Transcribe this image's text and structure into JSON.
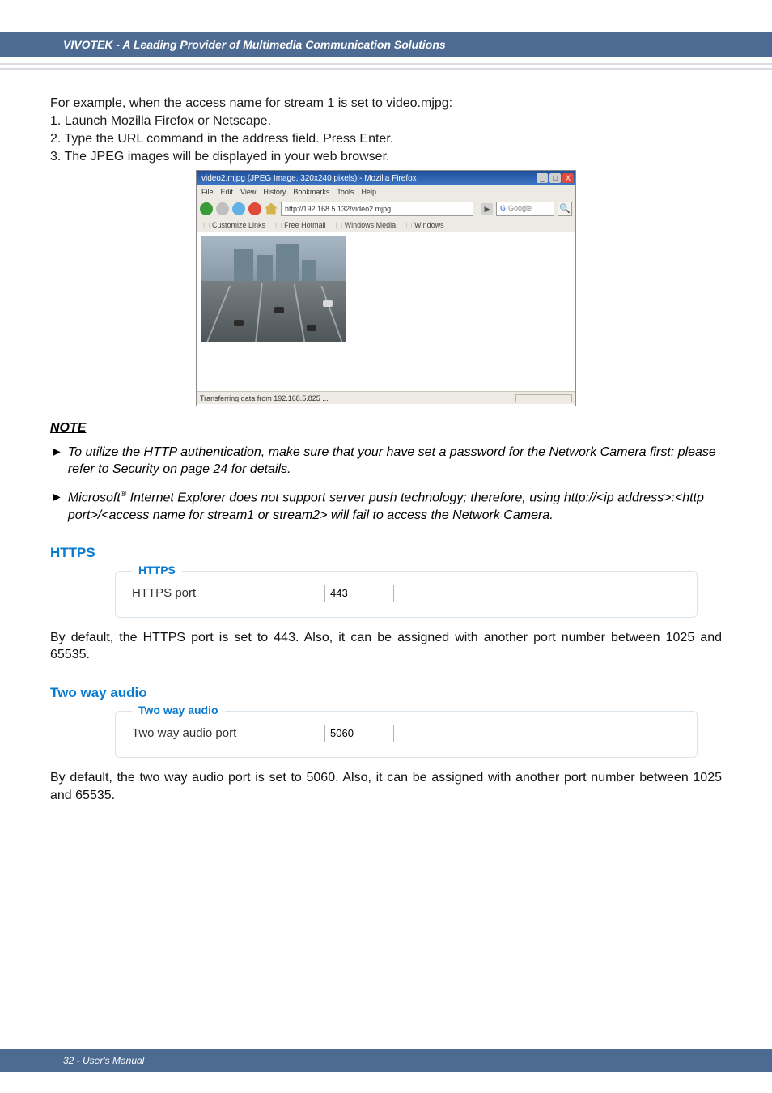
{
  "header": {
    "brand": "VIVOTEK - A Leading Provider of Multimedia Communication Solutions"
  },
  "intro": {
    "line0": "For example, when the access name for stream 1 is set to video.mjpg:",
    "line1": "1. Launch Mozilla Firefox or Netscape.",
    "line2": "2. Type the URL command in the address field. Press Enter.",
    "line3": "3. The JPEG images will be displayed in your web browser."
  },
  "firefox": {
    "title": "video2.mjpg (JPEG Image, 320x240 pixels) - Mozilla Firefox",
    "menus": [
      "File",
      "Edit",
      "View",
      "History",
      "Bookmarks",
      "Tools",
      "Help"
    ],
    "address": "http://192.168.5.132/video2.mjpg",
    "search_placeholder": "Google",
    "bookmarks": [
      "Customize Links",
      "Free Hotmail",
      "Windows Media",
      "Windows"
    ],
    "status": "Transferring data from 192.168.5.825 ...",
    "winbtn_min": "_",
    "winbtn_max": "□",
    "winbtn_close": "X",
    "go_glyph": "▶",
    "mag_glyph": "🔍"
  },
  "note": {
    "heading": "NOTE",
    "arrow": "►",
    "item1": "To utilize the HTTP authentication, make sure that your have set a password for the Network Camera first; please refer to Security on page 24  for details.",
    "item2_pre": "Microsoft",
    "item2_sup": "®",
    "item2_post": " Internet Explorer does not support server push technology; therefore, using http://<ip address>:<http port>/<access name for stream1 or stream2> will fail to access the Network Camera."
  },
  "https": {
    "heading": "HTTPS",
    "legend": "HTTPS",
    "label": "HTTPS port",
    "value": "443",
    "body": "By default, the HTTPS port is set to 443. Also, it can be assigned with another port number between 1025 and 65535."
  },
  "audio": {
    "heading": "Two way audio",
    "legend": "Two way audio",
    "label": "Two way audio port",
    "value": "5060",
    "body": "By default, the two way audio port is set to 5060. Also, it can be assigned with another port number between 1025 and 65535."
  },
  "footer": {
    "text": "32 - User's Manual"
  }
}
